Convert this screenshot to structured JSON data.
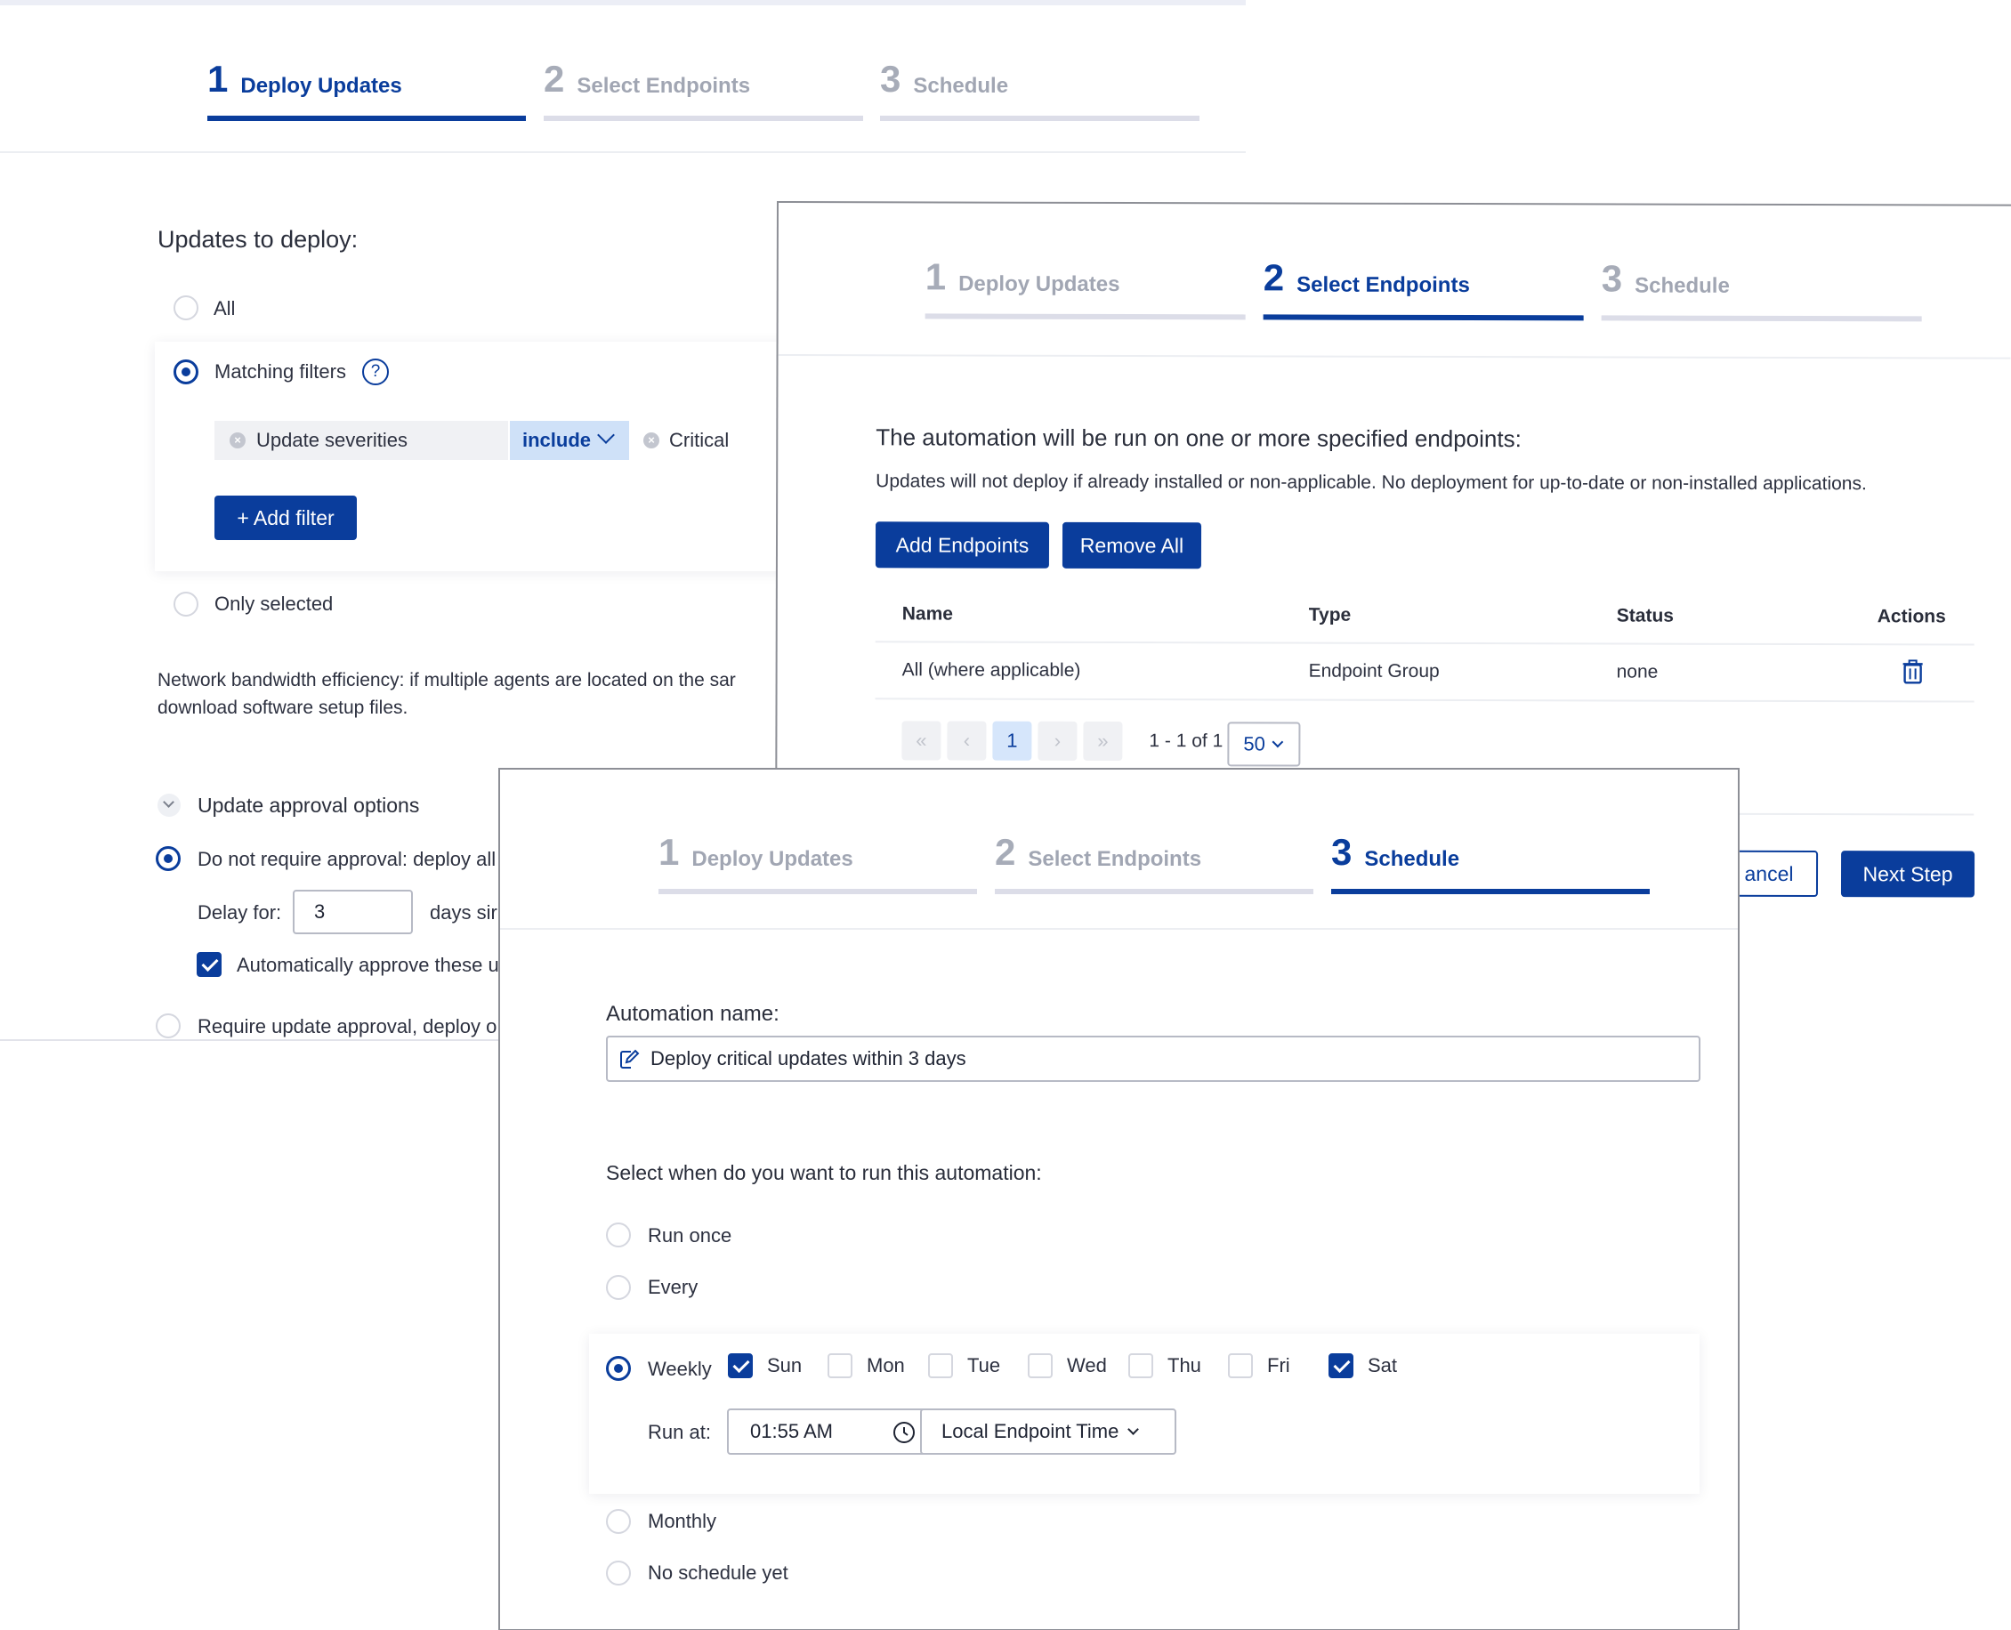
{
  "steps": [
    {
      "num": "1",
      "label": "Deploy Updates"
    },
    {
      "num": "2",
      "label": "Select Endpoints"
    },
    {
      "num": "3",
      "label": "Schedule"
    }
  ],
  "deploy": {
    "heading": "Updates to deploy:",
    "opt_all": "All",
    "opt_matching": "Matching filters",
    "help": "?",
    "filter_field": "Update severities",
    "filter_op": "include",
    "filter_value": "Critical",
    "add_filter": "+ Add filter",
    "opt_selected": "Only selected",
    "bandwidth_line1": "Network bandwidth efficiency: if multiple agents are located on the sar",
    "bandwidth_line2": "download software setup files.",
    "approval_heading": "Update approval options",
    "no_approval": "Do not require approval: deploy all",
    "delay_label": "Delay for:",
    "delay_value": "3",
    "days_since": "days sir",
    "auto_approve": "Automatically approve these u",
    "require_approval": "Require update approval, deploy o"
  },
  "endpoints": {
    "heading": "The automation will be run on one or more specified endpoints:",
    "note": "Updates will not deploy if already installed or non-applicable. No deployment for up-to-date or non-installed applications.",
    "add_btn": "Add Endpoints",
    "remove_btn": "Remove All",
    "columns": [
      "Name",
      "Type",
      "Status",
      "Actions"
    ],
    "rows": [
      {
        "name": "All (where applicable)",
        "type": "Endpoint Group",
        "status": "none"
      }
    ],
    "pager": {
      "first": "«",
      "prev": "‹",
      "current": "1",
      "next": "›",
      "last": "»",
      "range": "1 - 1 of 1",
      "per_page": "50"
    },
    "cancel_btn": "ancel",
    "next_btn": "Next Step"
  },
  "schedule": {
    "name_label": "Automation name:",
    "name_value": "Deploy critical updates within 3 days",
    "when_label": "Select when do you want to run this automation:",
    "run_once": "Run once",
    "every": "Every",
    "weekly": "Weekly",
    "days": [
      {
        "label": "Sun",
        "checked": true
      },
      {
        "label": "Mon",
        "checked": false
      },
      {
        "label": "Tue",
        "checked": false
      },
      {
        "label": "Wed",
        "checked": false
      },
      {
        "label": "Thu",
        "checked": false
      },
      {
        "label": "Fri",
        "checked": false
      },
      {
        "label": "Sat",
        "checked": true
      }
    ],
    "run_at_label": "Run at:",
    "run_at_value": "01:55 AM",
    "timezone": "Local Endpoint Time",
    "monthly": "Monthly",
    "no_schedule": "No schedule yet"
  },
  "colors": {
    "accent": "#0a3d9c",
    "muted": "#a1a6b3"
  }
}
